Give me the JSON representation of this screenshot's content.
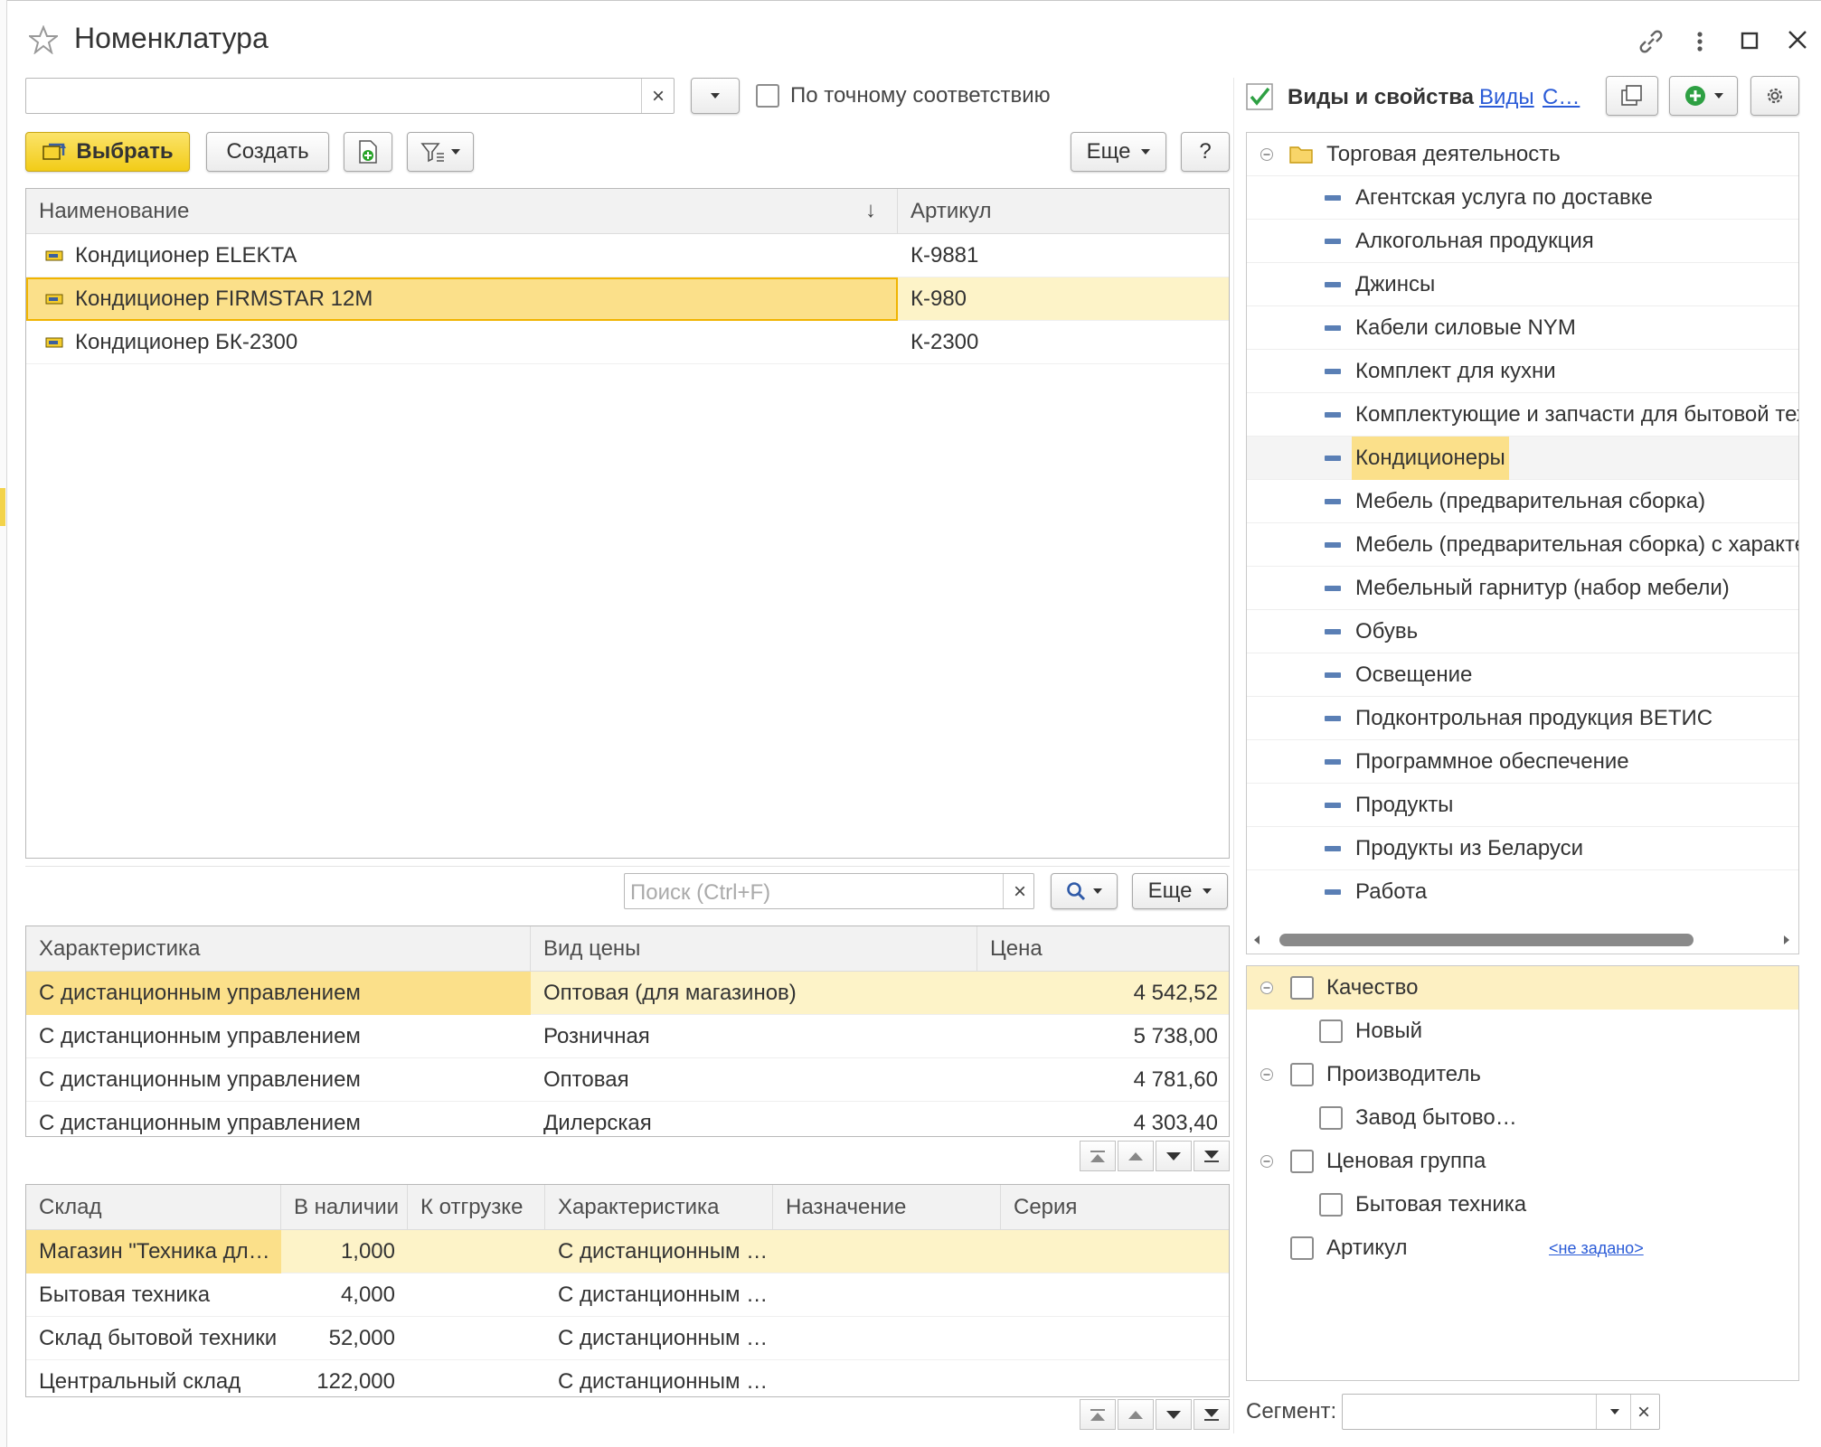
{
  "window": {
    "title": "Номенклатура"
  },
  "search": {
    "value": "",
    "clear": "×",
    "exact_match_label": "По точному соответствию"
  },
  "toolbar": {
    "select_label": "Выбрать",
    "create_label": "Создать",
    "more_label": "Еще",
    "help_label": "?"
  },
  "products": {
    "columns": [
      "Наименование",
      "Артикул"
    ],
    "sort_glyph": "↓",
    "rows": [
      {
        "name": "Кондиционер ELEKTA",
        "article": "К-9881"
      },
      {
        "name": "Кондиционер FIRMSTAR 12M",
        "article": "К-980"
      },
      {
        "name": "Кондиционер БК-2300",
        "article": "К-2300"
      }
    ]
  },
  "prices_search": {
    "placeholder": "Поиск (Ctrl+F)",
    "clear": "×",
    "more_label": "Еще"
  },
  "prices": {
    "columns": [
      "Характеристика",
      "Вид цены",
      "Цена"
    ],
    "rows": [
      {
        "characteristic": "С дистанционным управлением",
        "price_type": "Оптовая (для магазинов)",
        "price": "4 542,52"
      },
      {
        "characteristic": "С дистанционным управлением",
        "price_type": "Розничная",
        "price": "5 738,00"
      },
      {
        "characteristic": "С дистанционным управлением",
        "price_type": "Оптовая",
        "price": "4 781,60"
      },
      {
        "characteristic": "С дистанционным управлением",
        "price_type": "Дилерская",
        "price": "4 303,40"
      }
    ]
  },
  "stock": {
    "columns": [
      "Склад",
      "В наличии",
      "К отгрузке",
      "Характеристика",
      "Назначение",
      "Серия"
    ],
    "rows": [
      {
        "warehouse": "Магазин \"Техника для дома\"",
        "available": "1,000",
        "to_ship": "",
        "characteristic": "С дистанционным управлением",
        "purpose": "",
        "series": ""
      },
      {
        "warehouse": "Бытовая техника",
        "available": "4,000",
        "to_ship": "",
        "characteristic": "С дистанционным управлением",
        "purpose": "",
        "series": ""
      },
      {
        "warehouse": "Склад бытовой техники",
        "available": "52,000",
        "to_ship": "",
        "characteristic": "С дистанционным управлением",
        "purpose": "",
        "series": ""
      },
      {
        "warehouse": "Центральный склад",
        "available": "122,000",
        "to_ship": "",
        "characteristic": "С дистанционным управлением",
        "purpose": "",
        "series": ""
      }
    ]
  },
  "right_panel": {
    "header_label": "Виды и свойства",
    "link_types": "Виды",
    "link_more": "С…",
    "tree": {
      "root": "Торговая деятельность",
      "items": [
        "Агентская услуга по доставке",
        "Алкогольная продукция",
        "Джинсы",
        "Кабели силовые NYM",
        "Комплект для кухни",
        "Комплектующие и запчасти для бытовой техники",
        "Кондиционеры",
        "Мебель (предварительная сборка)",
        "Мебель (предварительная сборка) с характеристиками",
        "Мебельный гарнитур (набор мебели)",
        "Обувь",
        "Освещение",
        "Подконтрольная продукция ВЕТИС",
        "Программное обеспечение",
        "Продукты",
        "Продукты из Беларуси",
        "Работа"
      ],
      "selected_index": 6
    },
    "properties": [
      {
        "label": "Качество",
        "level": 0,
        "expanded": true,
        "selected": true,
        "value": ""
      },
      {
        "label": "Новый",
        "level": 1,
        "value": ""
      },
      {
        "label": "Производитель",
        "level": 0,
        "expanded": true,
        "value": ""
      },
      {
        "label": "Завод бытово…",
        "level": 1,
        "value": ""
      },
      {
        "label": "Ценовая группа",
        "level": 0,
        "expanded": true,
        "value": ""
      },
      {
        "label": "Бытовая техника",
        "level": 1,
        "value": ""
      },
      {
        "label": "Артикул",
        "level": 0,
        "value": "<не задано>"
      }
    ],
    "segment_label": "Сегмент:",
    "segment_value": "",
    "segment_clear": "×"
  },
  "colors": {
    "accent_yellow": "#f2cc17",
    "selection": "#fbe08a",
    "row_highlight": "#fdf3c8",
    "link": "#2a5bd7"
  }
}
